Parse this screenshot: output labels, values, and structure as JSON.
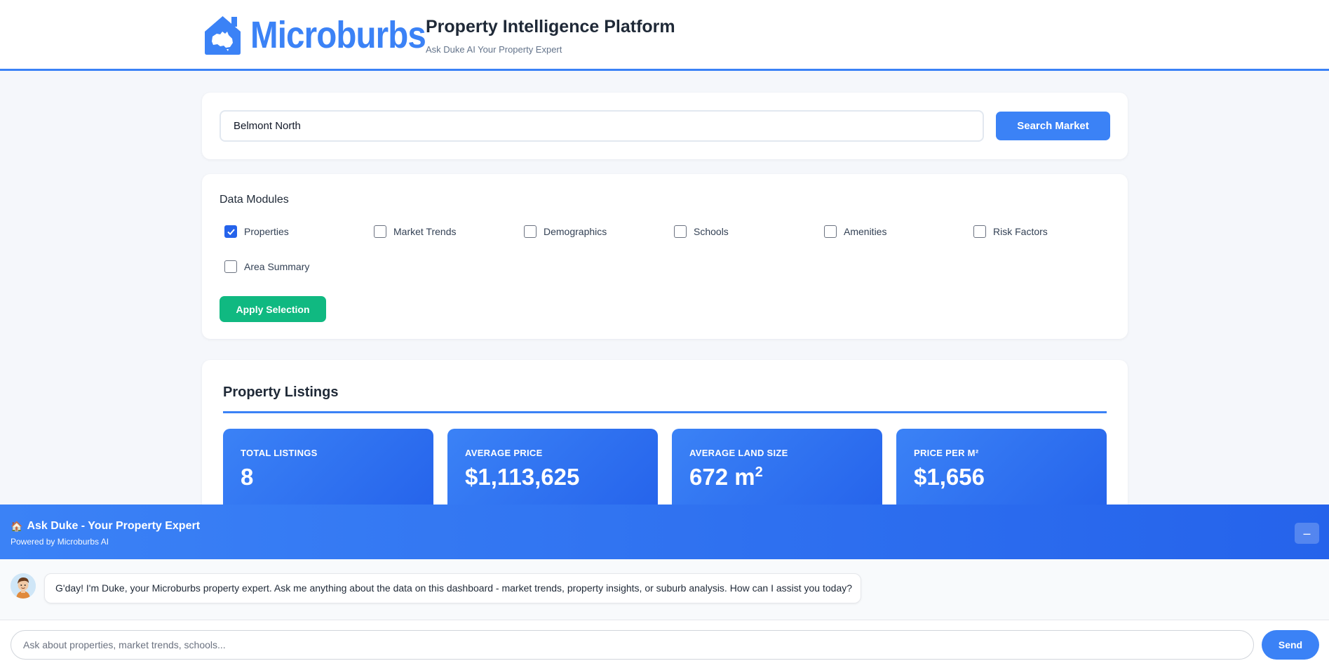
{
  "header": {
    "logo_text": "Microburbs",
    "title": "Property Intelligence Platform",
    "subtitle": "Ask Duke AI Your Property Expert"
  },
  "search": {
    "value": "Belmont North",
    "button_label": "Search Market"
  },
  "modules": {
    "title": "Data Modules",
    "items": [
      {
        "label": "Properties",
        "checked": true
      },
      {
        "label": "Market Trends",
        "checked": false
      },
      {
        "label": "Demographics",
        "checked": false
      },
      {
        "label": "Schools",
        "checked": false
      },
      {
        "label": "Amenities",
        "checked": false
      },
      {
        "label": "Risk Factors",
        "checked": false
      },
      {
        "label": "Area Summary",
        "checked": false
      }
    ],
    "apply_label": "Apply Selection"
  },
  "listings": {
    "title": "Property Listings",
    "stats": [
      {
        "label": "TOTAL LISTINGS",
        "value": "8"
      },
      {
        "label": "AVERAGE PRICE",
        "value": "$1,113,625"
      },
      {
        "label": "AVERAGE LAND SIZE",
        "value": "672 m",
        "value_sup": "2"
      },
      {
        "label": "PRICE PER M²",
        "value": "$1,656"
      }
    ]
  },
  "chat": {
    "title": "Ask Duke - Your Property Expert",
    "subtitle": "Powered by Microburbs AI",
    "minimize_label": "–",
    "message": "G'day! I'm Duke, your Microburbs property expert. Ask me anything about the data on this dashboard - market trends, property insights, or suburb analysis. How can I assist you today?",
    "input_placeholder": "Ask about properties, market trends, schools...",
    "send_label": "Send"
  },
  "colors": {
    "accent": "#3b82f6",
    "success": "#10b981",
    "background": "#f5f7fb"
  },
  "icons": [
    "house-australia-logo-icon",
    "house-emoji-icon",
    "check-icon",
    "duke-avatar"
  ]
}
